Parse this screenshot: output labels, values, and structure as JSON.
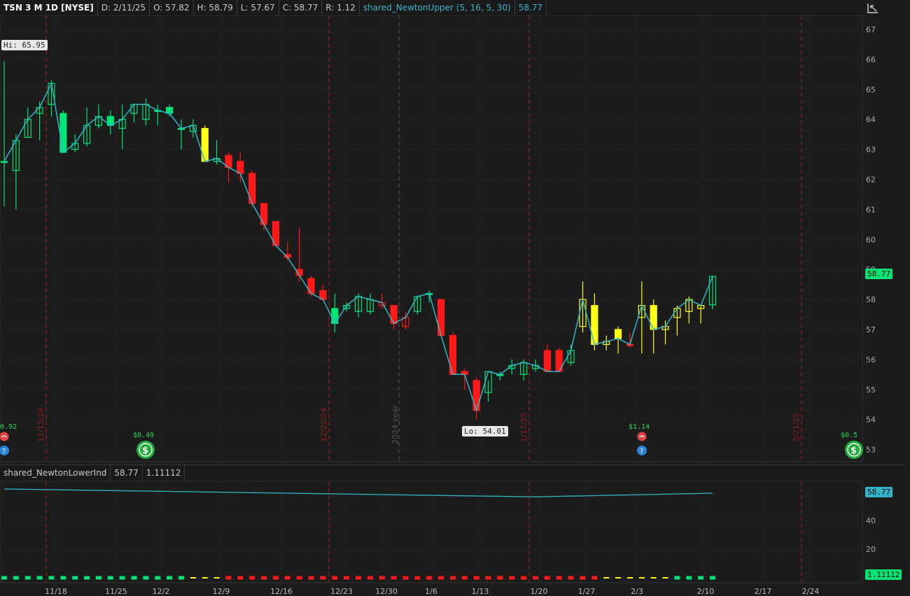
{
  "header": {
    "symbol": "TSN 3 M 1D [NYSE]",
    "date": "D: 2/11/25",
    "open": "O: 57.82",
    "high": "H: 58.79",
    "low": "L: 57.67",
    "close": "C: 58.77",
    "range": "R: 1.12",
    "study": "shared_NewtonUpper (5, 16, 5, 30)",
    "study_value": "58.77"
  },
  "lower": {
    "study": "shared_NewtonLowerInd",
    "value1": "58.77",
    "value2": "1.11112",
    "scale": [
      "40",
      "20"
    ],
    "tag_top": "58.77",
    "tag_bottom": "1.11112"
  },
  "labels": {
    "hi": "Hi: 65.95",
    "lo": "Lo: 54.01",
    "price_tag": "58.77",
    "year_marker": "2024 year"
  },
  "events": [
    {
      "label": "0.92",
      "icons": [
        "phone-icon",
        "earnings-icon"
      ]
    },
    {
      "label": "$0.49",
      "icons": [
        "dividend-icon"
      ]
    },
    {
      "label": "$1.14",
      "icons": [
        "phone-icon",
        "earnings-icon"
      ]
    },
    {
      "label": "$0.5",
      "icons": [
        "dividend-icon"
      ]
    }
  ],
  "colors": {
    "up": "#00e676",
    "down": "#ff1a1a",
    "neutral": "#ffff1a",
    "study": "#33b5c9",
    "grid": "#2c2c2c",
    "vline": "#b01c1c"
  },
  "chart_data": {
    "type": "candlestick",
    "y_axis": {
      "ticks": [
        53,
        54,
        55,
        56,
        57,
        58,
        59,
        60,
        61,
        62,
        63,
        64,
        65,
        66,
        67
      ]
    },
    "x_ticks": [
      "11/18",
      "11/25",
      "12/2",
      "12/9",
      "12/16",
      "12/23",
      "12/30",
      "1/6",
      "1/13",
      "1/20",
      "1/27",
      "2/3",
      "2/10",
      "2/17",
      "2/24"
    ],
    "vertical_markers": [
      "11/15/24",
      "12/20/24",
      "1/17/25",
      "2/21/25"
    ],
    "candles": [
      {
        "o": 62.6,
        "h": 65.95,
        "l": 61.1,
        "c": 62.6,
        "col": "up"
      },
      {
        "o": 62.3,
        "h": 63.5,
        "l": 61.0,
        "c": 63.3,
        "col": "up"
      },
      {
        "o": 63.4,
        "h": 64.4,
        "l": 63.4,
        "c": 64.0,
        "col": "up"
      },
      {
        "o": 64.2,
        "h": 64.6,
        "l": 63.3,
        "c": 64.4,
        "col": "up"
      },
      {
        "o": 64.5,
        "h": 65.3,
        "l": 64.1,
        "c": 65.2,
        "col": "up"
      },
      {
        "o": 64.2,
        "h": 64.3,
        "l": 62.9,
        "c": 62.9,
        "col": "up"
      },
      {
        "o": 63.0,
        "h": 63.5,
        "l": 62.9,
        "c": 63.2,
        "col": "up"
      },
      {
        "o": 63.2,
        "h": 64.4,
        "l": 63.1,
        "c": 63.8,
        "col": "up"
      },
      {
        "o": 63.8,
        "h": 64.5,
        "l": 63.7,
        "c": 64.1,
        "col": "up"
      },
      {
        "o": 64.1,
        "h": 64.3,
        "l": 63.5,
        "c": 63.8,
        "col": "up"
      },
      {
        "o": 63.7,
        "h": 64.5,
        "l": 63.0,
        "c": 64.0,
        "col": "up"
      },
      {
        "o": 64.2,
        "h": 64.5,
        "l": 63.9,
        "c": 64.5,
        "col": "up"
      },
      {
        "o": 64.0,
        "h": 64.7,
        "l": 63.8,
        "c": 64.5,
        "col": "up"
      },
      {
        "o": 64.3,
        "h": 64.5,
        "l": 63.8,
        "c": 64.3,
        "col": "up"
      },
      {
        "o": 64.4,
        "h": 64.5,
        "l": 64.1,
        "c": 64.2,
        "col": "up"
      },
      {
        "o": 63.7,
        "h": 64.0,
        "l": 63.0,
        "c": 63.7,
        "col": "up"
      },
      {
        "o": 63.6,
        "h": 64.0,
        "l": 63.4,
        "c": 63.8,
        "col": "up"
      },
      {
        "o": 63.7,
        "h": 63.8,
        "l": 62.6,
        "c": 62.6,
        "col": "neutral"
      },
      {
        "o": 62.6,
        "h": 63.3,
        "l": 62.5,
        "c": 62.7,
        "col": "up"
      },
      {
        "o": 62.8,
        "h": 62.9,
        "l": 61.9,
        "c": 62.4,
        "col": "down"
      },
      {
        "o": 62.6,
        "h": 62.9,
        "l": 61.9,
        "c": 62.2,
        "col": "down"
      },
      {
        "o": 62.2,
        "h": 62.3,
        "l": 61.1,
        "c": 61.2,
        "col": "down"
      },
      {
        "o": 61.2,
        "h": 61.2,
        "l": 60.3,
        "c": 60.5,
        "col": "down"
      },
      {
        "o": 60.6,
        "h": 60.6,
        "l": 59.8,
        "c": 59.8,
        "col": "down"
      },
      {
        "o": 59.5,
        "h": 59.9,
        "l": 59.3,
        "c": 59.4,
        "col": "down"
      },
      {
        "o": 59.0,
        "h": 60.4,
        "l": 58.6,
        "c": 58.8,
        "col": "down"
      },
      {
        "o": 58.7,
        "h": 58.8,
        "l": 58.1,
        "c": 58.2,
        "col": "down"
      },
      {
        "o": 58.3,
        "h": 58.5,
        "l": 58.0,
        "c": 58.0,
        "col": "down"
      },
      {
        "o": 57.7,
        "h": 58.2,
        "l": 56.9,
        "c": 57.2,
        "col": "up"
      },
      {
        "o": 57.7,
        "h": 57.9,
        "l": 57.6,
        "c": 57.8,
        "col": "up"
      },
      {
        "o": 57.6,
        "h": 58.2,
        "l": 57.4,
        "c": 58.1,
        "col": "up"
      },
      {
        "o": 57.6,
        "h": 58.2,
        "l": 57.5,
        "c": 58.0,
        "col": "up"
      },
      {
        "o": 57.8,
        "h": 58.2,
        "l": 57.7,
        "c": 57.9,
        "col": "down"
      },
      {
        "o": 57.8,
        "h": 57.8,
        "l": 57.0,
        "c": 57.2,
        "col": "down"
      },
      {
        "o": 57.1,
        "h": 57.6,
        "l": 57.0,
        "c": 57.4,
        "col": "down"
      },
      {
        "o": 57.6,
        "h": 58.1,
        "l": 57.5,
        "c": 58.1,
        "col": "up"
      },
      {
        "o": 58.2,
        "h": 58.3,
        "l": 57.9,
        "c": 58.2,
        "col": "up"
      },
      {
        "o": 58.0,
        "h": 58.0,
        "l": 56.8,
        "c": 56.8,
        "col": "down"
      },
      {
        "o": 56.8,
        "h": 56.9,
        "l": 55.5,
        "c": 55.5,
        "col": "down"
      },
      {
        "o": 55.6,
        "h": 55.7,
        "l": 55.0,
        "c": 55.5,
        "col": "down"
      },
      {
        "o": 55.3,
        "h": 55.4,
        "l": 54.01,
        "c": 54.3,
        "col": "down"
      },
      {
        "o": 54.9,
        "h": 55.3,
        "l": 54.6,
        "c": 55.6,
        "col": "up"
      },
      {
        "o": 55.5,
        "h": 55.6,
        "l": 55.3,
        "c": 55.5,
        "col": "up"
      },
      {
        "o": 55.7,
        "h": 56.0,
        "l": 55.5,
        "c": 55.8,
        "col": "up"
      },
      {
        "o": 55.5,
        "h": 56.0,
        "l": 55.3,
        "c": 55.9,
        "col": "up"
      },
      {
        "o": 55.7,
        "h": 56.0,
        "l": 55.6,
        "c": 55.8,
        "col": "up"
      },
      {
        "o": 56.3,
        "h": 56.5,
        "l": 55.6,
        "c": 55.6,
        "col": "down"
      },
      {
        "o": 56.3,
        "h": 56.4,
        "l": 55.6,
        "c": 55.6,
        "col": "down"
      },
      {
        "o": 55.9,
        "h": 56.5,
        "l": 55.8,
        "c": 56.3,
        "col": "up"
      },
      {
        "o": 57.1,
        "h": 58.6,
        "l": 56.9,
        "c": 58.0,
        "col": "neutral"
      },
      {
        "o": 57.8,
        "h": 58.2,
        "l": 56.3,
        "c": 56.5,
        "col": "neutral"
      },
      {
        "o": 56.5,
        "h": 56.8,
        "l": 56.3,
        "c": 56.6,
        "col": "neutral"
      },
      {
        "o": 57.0,
        "h": 57.1,
        "l": 56.2,
        "c": 56.7,
        "col": "neutral"
      },
      {
        "o": 56.5,
        "h": 56.9,
        "l": 56.4,
        "c": 56.5,
        "col": "down"
      },
      {
        "o": 57.4,
        "h": 58.6,
        "l": 56.2,
        "c": 57.8,
        "col": "neutral"
      },
      {
        "o": 57.8,
        "h": 58.0,
        "l": 56.2,
        "c": 57.0,
        "col": "neutral"
      },
      {
        "o": 57.0,
        "h": 57.3,
        "l": 56.5,
        "c": 57.1,
        "col": "neutral"
      },
      {
        "o": 57.4,
        "h": 57.8,
        "l": 56.8,
        "c": 57.7,
        "col": "neutral"
      },
      {
        "o": 57.6,
        "h": 58.1,
        "l": 57.2,
        "c": 58.0,
        "col": "neutral"
      },
      {
        "o": 57.7,
        "h": 57.8,
        "l": 57.2,
        "c": 57.8,
        "col": "neutral"
      },
      {
        "o": 57.82,
        "h": 58.79,
        "l": 57.67,
        "c": 58.77,
        "col": "up"
      }
    ],
    "lower_histogram": {
      "colors": [
        "up",
        "up",
        "up",
        "up",
        "up",
        "up",
        "up",
        "up",
        "up",
        "up",
        "up",
        "up",
        "up",
        "up",
        "up",
        "up",
        "neutral",
        "neutral",
        "neutral",
        "down",
        "down",
        "down",
        "down",
        "down",
        "down",
        "down",
        "down",
        "down",
        "down",
        "down",
        "down",
        "down",
        "down",
        "down",
        "down",
        "down",
        "down",
        "down",
        "down",
        "down",
        "down",
        "down",
        "down",
        "down",
        "down",
        "down",
        "down",
        "down",
        "down",
        "down",
        "down",
        "neutral",
        "neutral",
        "neutral",
        "neutral",
        "neutral",
        "neutral",
        "up",
        "up",
        "up",
        "up"
      ]
    }
  }
}
